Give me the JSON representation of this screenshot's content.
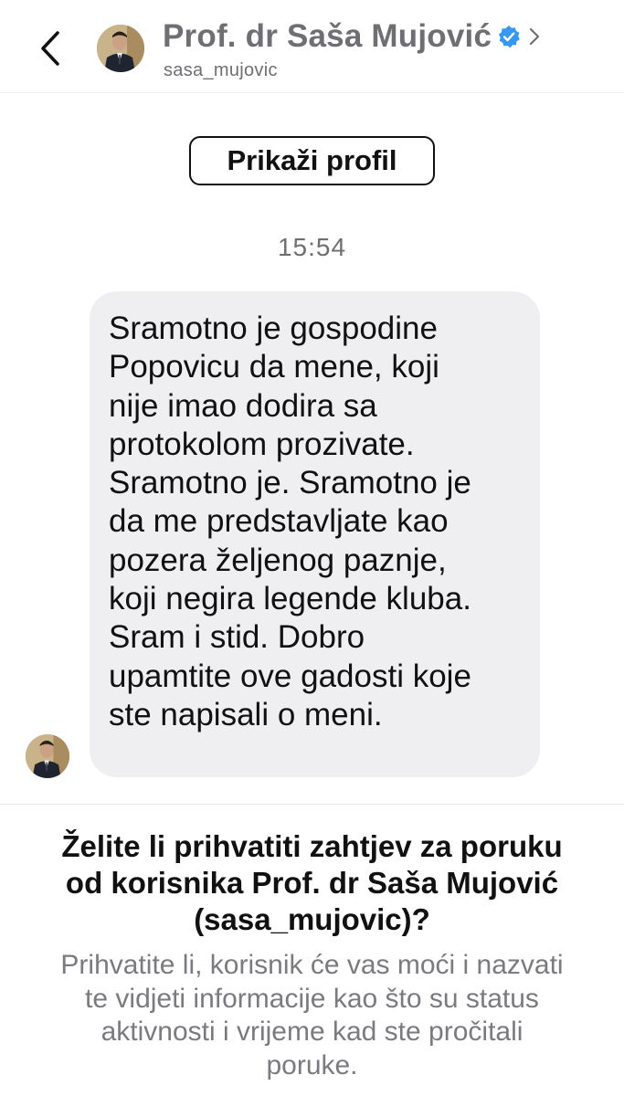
{
  "header": {
    "display_name": "Prof. dr Saša Mujović",
    "username": "sasa_mujovic",
    "icons": [
      "back-chevron-icon",
      "avatar",
      "verified-badge-icon",
      "chevron-right-icon"
    ],
    "colors": {
      "name": "#6e6e73",
      "verified": "#3897f0"
    }
  },
  "profile_button": {
    "label": "Prikaži profil"
  },
  "conversation": {
    "timestamp": "15:54",
    "message": "Sramotno je gospodine\nPopovicu da mene, koji\nnije imao dodira sa\nprotokolom prozivate.\nSramotno je. Sramotno je\nda me predstavljate kao\npozera željenog paznje,\nkoji negira legende kluba.\nSram i stid. Dobro\nupamtite ove gadosti koje\nste napisali o meni.",
    "bubble_color": "#efeff2"
  },
  "request": {
    "title": "Želite li prihvatiti zahtjev za poruku\nod korisnika Prof. dr Saša Mujović\n(sasa_mujovic)?",
    "body": "Prihvatite li, korisnik će vas moći i nazvati\nte vidjeti informacije kao što su status\naktivnosti i vrijeme kad ste pročitali\nporuke."
  }
}
